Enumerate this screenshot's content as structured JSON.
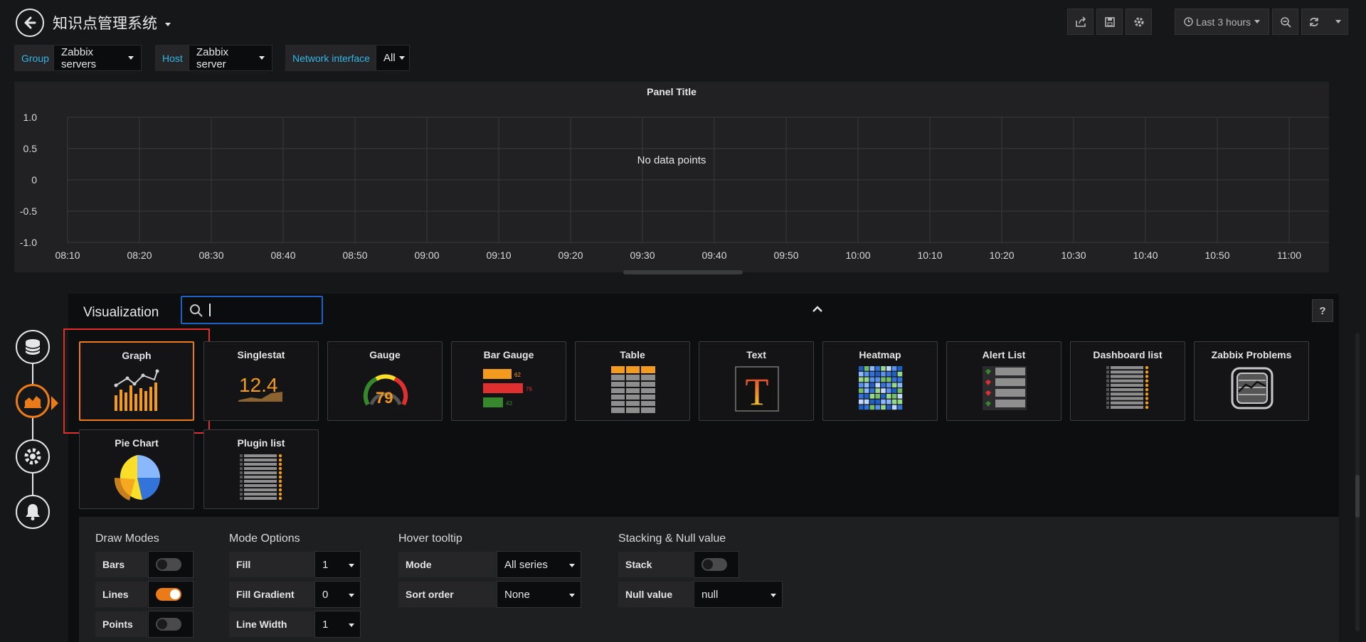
{
  "header": {
    "title": "知识点管理系统",
    "time_range": "Last 3 hours"
  },
  "variables": [
    {
      "label": "Group",
      "value": "Zabbix servers"
    },
    {
      "label": "Host",
      "value": "Zabbix server"
    },
    {
      "label": "Network interface",
      "value": "All"
    }
  ],
  "panel": {
    "title": "Panel Title",
    "no_data": "No data points"
  },
  "chart_data": {
    "type": "line",
    "title": "Panel Title",
    "x": [
      "08:10",
      "08:20",
      "08:30",
      "08:40",
      "08:50",
      "09:00",
      "09:10",
      "09:20",
      "09:30",
      "09:40",
      "09:50",
      "10:00",
      "10:10",
      "10:20",
      "10:30",
      "10:40",
      "10:50",
      "11:00"
    ],
    "series": [],
    "y_ticks": [
      "1.0",
      "0.5",
      "0",
      "-0.5",
      "-1.0"
    ],
    "ylim": [
      -1.0,
      1.0
    ],
    "grid": true,
    "annotation": "No data points"
  },
  "visualization": {
    "heading": "Visualization",
    "search_placeholder": "",
    "help": "?",
    "types": [
      {
        "name": "Graph",
        "icon": "graph-icon",
        "selected": true
      },
      {
        "name": "Singlestat",
        "icon": "singlestat-icon",
        "value": "12.4"
      },
      {
        "name": "Gauge",
        "icon": "gauge-icon",
        "value": "79"
      },
      {
        "name": "Bar Gauge",
        "icon": "bar-gauge-icon",
        "values": [
          "62",
          "76",
          "43"
        ]
      },
      {
        "name": "Table",
        "icon": "table-icon"
      },
      {
        "name": "Text",
        "icon": "text-icon",
        "glyph": "T"
      },
      {
        "name": "Heatmap",
        "icon": "heatmap-icon"
      },
      {
        "name": "Alert List",
        "icon": "alert-list-icon"
      },
      {
        "name": "Dashboard list",
        "icon": "dashboard-list-icon"
      },
      {
        "name": "Zabbix Problems",
        "icon": "zabbix-problems-icon"
      },
      {
        "name": "Pie Chart",
        "icon": "pie-chart-icon"
      },
      {
        "name": "Plugin list",
        "icon": "plugin-list-icon"
      }
    ]
  },
  "options": {
    "draw_modes": {
      "heading": "Draw Modes",
      "bars": "Bars",
      "lines": "Lines",
      "points": "Points",
      "bars_on": false,
      "lines_on": true,
      "points_on": false
    },
    "mode_options": {
      "heading": "Mode Options",
      "fill": "Fill",
      "fill_value": "1",
      "fill_gradient": "Fill Gradient",
      "fill_gradient_value": "0",
      "line_width": "Line Width",
      "line_width_value": "1"
    },
    "hover_tooltip": {
      "heading": "Hover tooltip",
      "mode": "Mode",
      "mode_value": "All series",
      "sort_order": "Sort order",
      "sort_order_value": "None"
    },
    "stacking": {
      "heading": "Stacking & Null value",
      "stack": "Stack",
      "stack_on": false,
      "null_value": "Null value",
      "null_value_value": "null"
    }
  },
  "colors": {
    "accent": "#eb7b18",
    "selected_outline": "#e02f2f",
    "variable_label": "#33b5e5"
  }
}
